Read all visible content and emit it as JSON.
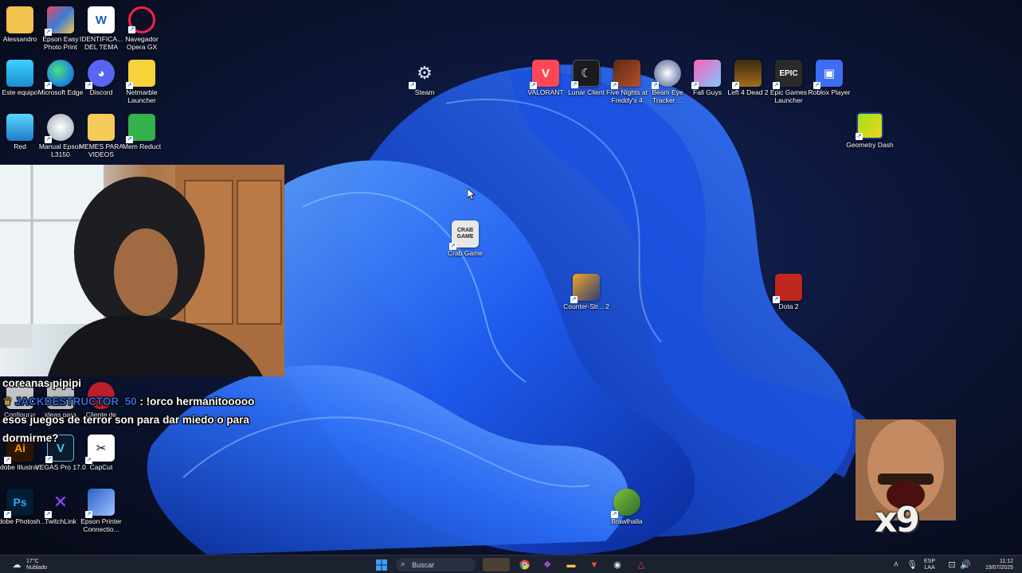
{
  "desktop_icons": {
    "alessandro": "Alessandro",
    "epson_easy": "Epson Easy Photo Print",
    "identifica": "IDENTIFICA... DEL TEMA",
    "opera_gx": "Navegador Opera GX",
    "este_equipo": "Este equipo",
    "edge": "Microsoft Edge",
    "discord": "Discord",
    "netmarble": "Netmarble Launcher",
    "red": "Red",
    "manual_epson": "Manual Epson L3150",
    "memes": "MEMES PARA VIDEOS",
    "mem_reduct": "Mem Reduct",
    "steam": "Steam",
    "valorant": "VALORANT",
    "lunar": "Lunar Client",
    "fnaf": "Five Nights at Freddy's 4",
    "beam_eye": "Beam Eye Tracker ...",
    "fall_guys": "Fall Guys",
    "l4d2": "Left 4 Dead 2",
    "epic": "Epic Games Launcher",
    "roblox": "Roblox Player",
    "geometry_dash": "Geometry Dash",
    "crab_game": "Crab Game",
    "counter_strike": "Counter-Str... 2",
    "dota2": "Dota 2",
    "brawlhalla": "Brawlhalla",
    "configurar": "Configurar",
    "ideas": "ideas para",
    "cliente": "Cliente de",
    "adobe_illustrator": "Adobe Illustrat...",
    "vegas": "VEGAS Pro 17.0",
    "capcut": "CapCut",
    "adobe_photoshop": "Adobe Photosh...",
    "twitchlink": "TwitchLink",
    "epson_printer": "Epson Printer Connectio..."
  },
  "icon_glyphs": {
    "crab_game": "CRAB GAME",
    "epic": "EPIC",
    "illustrator": "Ai",
    "photoshop": "Ps",
    "vegas": "V"
  },
  "chat": {
    "line1": "coreanas pipipi",
    "line2_user": "JACKDESTRUCTOR_50",
    "line2_text": " : !orco hermanitooooo",
    "line3": "esos juegos de terror son para dar miedo o para dormirme?"
  },
  "overlay": {
    "meme_badge": "x9"
  },
  "taskbar": {
    "weather_temp": "17°C",
    "weather_desc": "Nublado",
    "search_placeholder": "Buscar",
    "lang_line1": "ESP",
    "lang_line2": "LAA",
    "time": "11:12",
    "date": "19/07/2025"
  },
  "colors": {
    "wallpaper_bg": "#0a1020",
    "bloom_primary": "#1e5cf0",
    "taskbar_bg": "#1c2130",
    "chat_username": "#2f6be0"
  }
}
